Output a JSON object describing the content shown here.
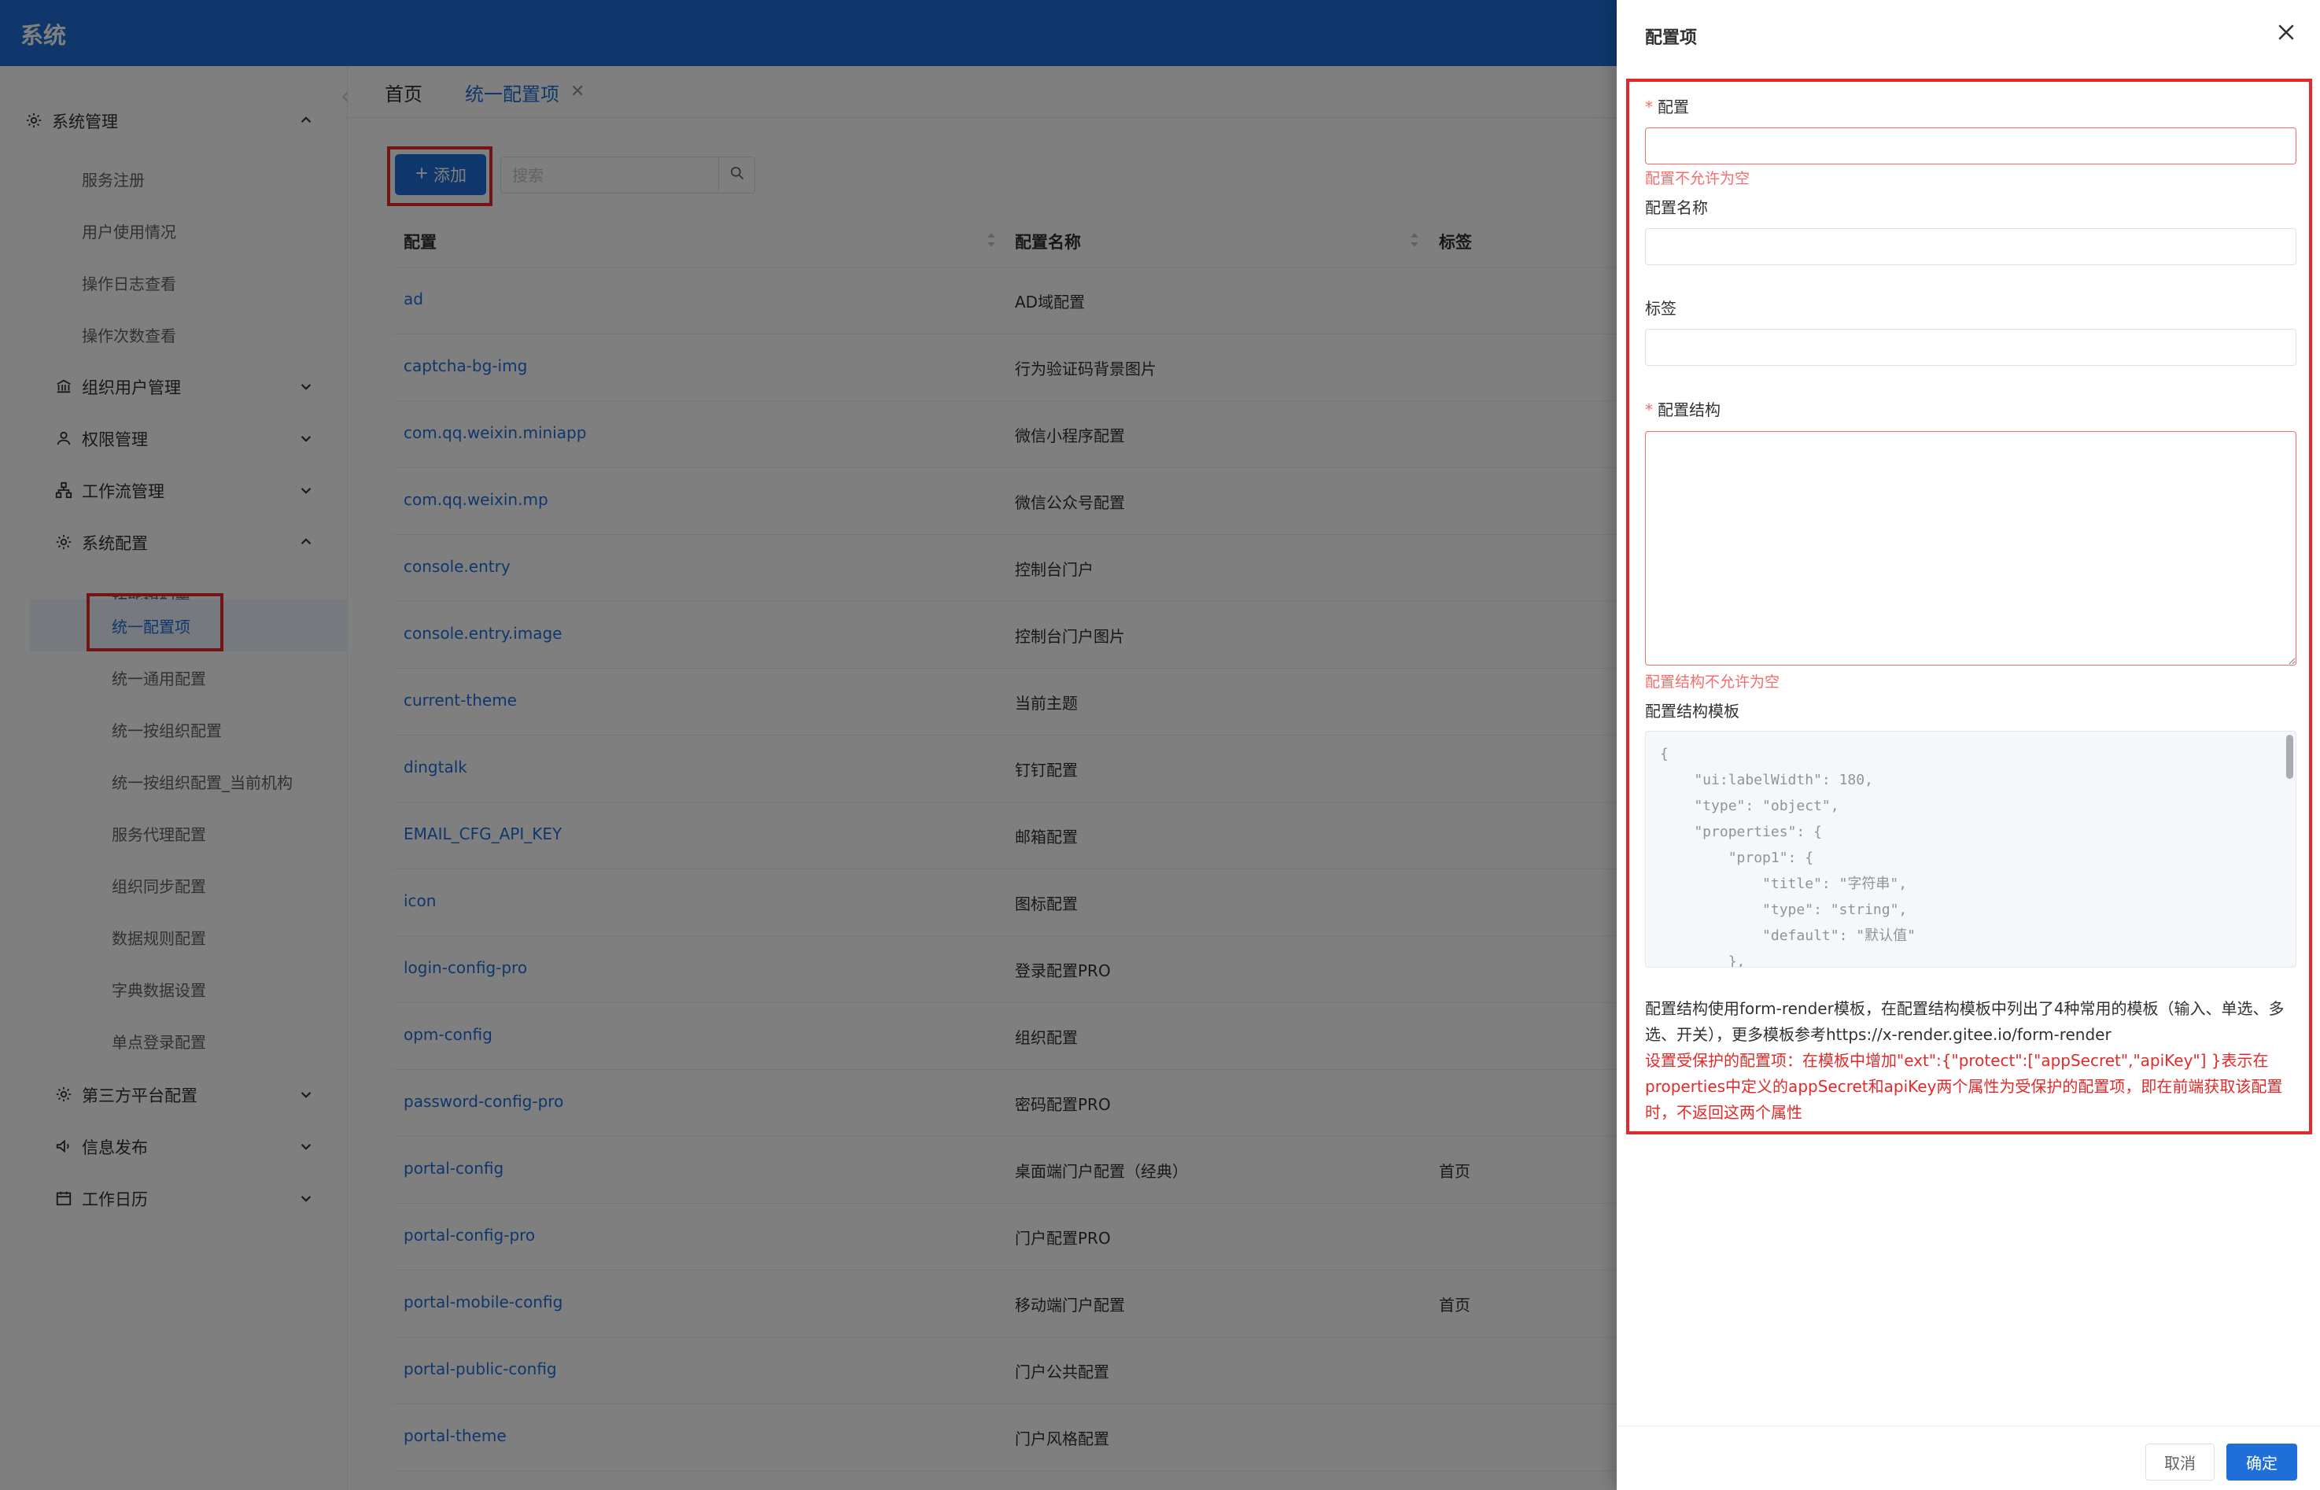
{
  "app": {
    "title": "系统"
  },
  "sidebar": {
    "groups": [
      {
        "label": "系统管理"
      },
      {
        "label": "组织用户管理"
      },
      {
        "label": "权限管理"
      },
      {
        "label": "工作流管理"
      },
      {
        "label": "系统配置"
      },
      {
        "label": "第三方平台配置"
      },
      {
        "label": "信息发布"
      },
      {
        "label": "工作日历"
      }
    ],
    "system_mgmt_items": [
      {
        "label": "服务注册"
      },
      {
        "label": "用户使用情况"
      },
      {
        "label": "操作日志查看"
      },
      {
        "label": "操作次数查看"
      }
    ],
    "system_config_items": [
      {
        "label": "功能树配置"
      },
      {
        "label": "统一配置项"
      },
      {
        "label": "统一通用配置"
      },
      {
        "label": "统一按组织配置"
      },
      {
        "label": "统一按组织配置_当前机构"
      },
      {
        "label": "服务代理配置"
      },
      {
        "label": "组织同步配置"
      },
      {
        "label": "数据规则配置"
      },
      {
        "label": "字典数据设置"
      },
      {
        "label": "单点登录配置"
      }
    ]
  },
  "tabs": {
    "home": "首页",
    "current": "统一配置项",
    "close": "✕"
  },
  "toolbar": {
    "add_label": "添加",
    "search_placeholder": "搜索"
  },
  "table": {
    "columns": [
      "配置",
      "配置名称",
      "标签"
    ],
    "rows": [
      {
        "key": "ad",
        "name": "AD域配置",
        "tag": ""
      },
      {
        "key": "captcha-bg-img",
        "name": "行为验证码背景图片",
        "tag": ""
      },
      {
        "key": "com.qq.weixin.miniapp",
        "name": "微信小程序配置",
        "tag": ""
      },
      {
        "key": "com.qq.weixin.mp",
        "name": "微信公众号配置",
        "tag": ""
      },
      {
        "key": "console.entry",
        "name": "控制台门户",
        "tag": ""
      },
      {
        "key": "console.entry.image",
        "name": "控制台门户图片",
        "tag": ""
      },
      {
        "key": "current-theme",
        "name": "当前主题",
        "tag": ""
      },
      {
        "key": "dingtalk",
        "name": "钉钉配置",
        "tag": ""
      },
      {
        "key": "EMAIL_CFG_API_KEY",
        "name": "邮箱配置",
        "tag": ""
      },
      {
        "key": "icon",
        "name": "图标配置",
        "tag": ""
      },
      {
        "key": "login-config-pro",
        "name": "登录配置PRO",
        "tag": ""
      },
      {
        "key": "opm-config",
        "name": "组织配置",
        "tag": ""
      },
      {
        "key": "password-config-pro",
        "name": "密码配置PRO",
        "tag": ""
      },
      {
        "key": "portal-config",
        "name": "桌面端门户配置（经典）",
        "tag": "首页"
      },
      {
        "key": "portal-config-pro",
        "name": "门户配置PRO",
        "tag": ""
      },
      {
        "key": "portal-mobile-config",
        "name": "移动端门户配置",
        "tag": "首页"
      },
      {
        "key": "portal-public-config",
        "name": "门户公共配置",
        "tag": ""
      },
      {
        "key": "portal-theme",
        "name": "门户风格配置",
        "tag": ""
      }
    ]
  },
  "drawer": {
    "title": "配置项",
    "required_mark": "*",
    "fields": {
      "config_label": "配置",
      "config_value": "",
      "config_error": "配置不允许为空",
      "name_label": "配置名称",
      "name_value": "",
      "tag_label": "标签",
      "tag_value": "",
      "struct_label": "配置结构",
      "struct_value": "",
      "struct_error": "配置结构不允许为空",
      "template_label": "配置结构模板",
      "template_code": "{\n    \"ui:labelWidth\": 180,\n    \"type\": \"object\",\n    \"properties\": {\n        \"prop1\": {\n            \"title\": \"字符串\",\n            \"type\": \"string\",\n            \"default\": \"默认值\"\n        },"
    },
    "help_text": "配置结构使用form-render模板，在配置结构模板中列出了4种常用的模板（输入、单选、多选、开关），更多模板参考https://x-render.gitee.io/form-render",
    "warn_text": "设置受保护的配置项：在模板中增加\"ext\":{\"protect\":[\"appSecret\",\"apiKey\"] }表示在properties中定义的appSecret和apiKey两个属性为受保护的配置项，即在前端获取该配置时，不返回这两个属性",
    "cancel_label": "取消",
    "ok_label": "确定"
  },
  "colors": {
    "primary": "#1e6fd8",
    "error": "#f56c6c",
    "annotation": "#e32a2a"
  }
}
